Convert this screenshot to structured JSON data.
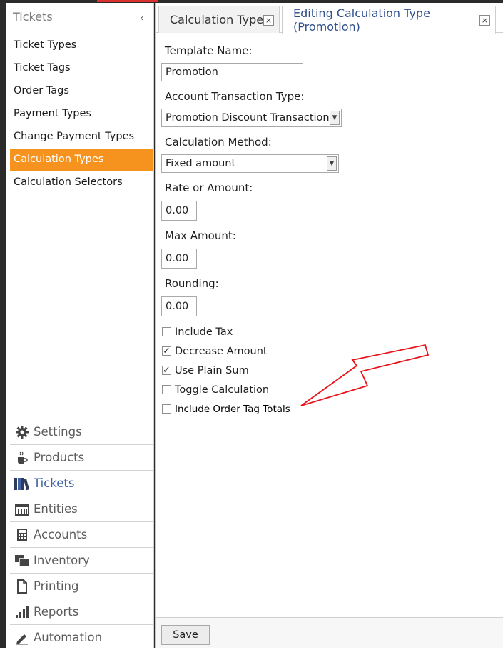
{
  "sidebar": {
    "header": "Tickets",
    "collapse_glyph": "‹",
    "items": [
      {
        "label": "Ticket Types"
      },
      {
        "label": "Ticket Tags"
      },
      {
        "label": "Order Tags"
      },
      {
        "label": "Payment Types"
      },
      {
        "label": "Change Payment Types"
      },
      {
        "label": "Calculation Types",
        "active": true
      },
      {
        "label": "Calculation Selectors"
      }
    ],
    "nav": [
      {
        "label": "Settings",
        "icon": "gear-icon"
      },
      {
        "label": "Products",
        "icon": "coffee-cup-icon"
      },
      {
        "label": "Tickets",
        "icon": "books-icon",
        "active": true
      },
      {
        "label": "Entities",
        "icon": "calendar-grid-icon"
      },
      {
        "label": "Accounts",
        "icon": "calculator-icon"
      },
      {
        "label": "Inventory",
        "icon": "stacked-windows-icon"
      },
      {
        "label": "Printing",
        "icon": "document-icon"
      },
      {
        "label": "Reports",
        "icon": "bar-chart-icon"
      },
      {
        "label": "Automation",
        "icon": "pencil-icon"
      }
    ],
    "accent_color": "#f5931e"
  },
  "tabs": [
    {
      "label": "Calculation Types",
      "close": "×"
    },
    {
      "label": "Editing Calculation Type (Promotion)",
      "close": "×"
    }
  ],
  "form": {
    "template_name_label": "Template Name:",
    "template_name_value": "Promotion",
    "account_transaction_type_label": "Account Transaction Type:",
    "account_transaction_type_value": "Promotion Discount Transaction",
    "calculation_method_label": "Calculation Method:",
    "calculation_method_value": "Fixed amount",
    "rate_label": "Rate or Amount:",
    "rate_value": "0.00",
    "max_amount_label": "Max Amount:",
    "max_amount_value": "0.00",
    "rounding_label": "Rounding:",
    "rounding_value": "0.00",
    "checkboxes": [
      {
        "label": "Include Tax",
        "checked": false
      },
      {
        "label": "Decrease Amount",
        "checked": true
      },
      {
        "label": "Use Plain Sum",
        "checked": true
      },
      {
        "label": "Toggle Calculation",
        "checked": false
      },
      {
        "label": "Include Order Tag Totals",
        "checked": false
      }
    ],
    "combo_arrow": "▼",
    "check_glyph": "✓"
  },
  "footer": {
    "save_label": "Save"
  },
  "annotation_color": "#e8141b"
}
